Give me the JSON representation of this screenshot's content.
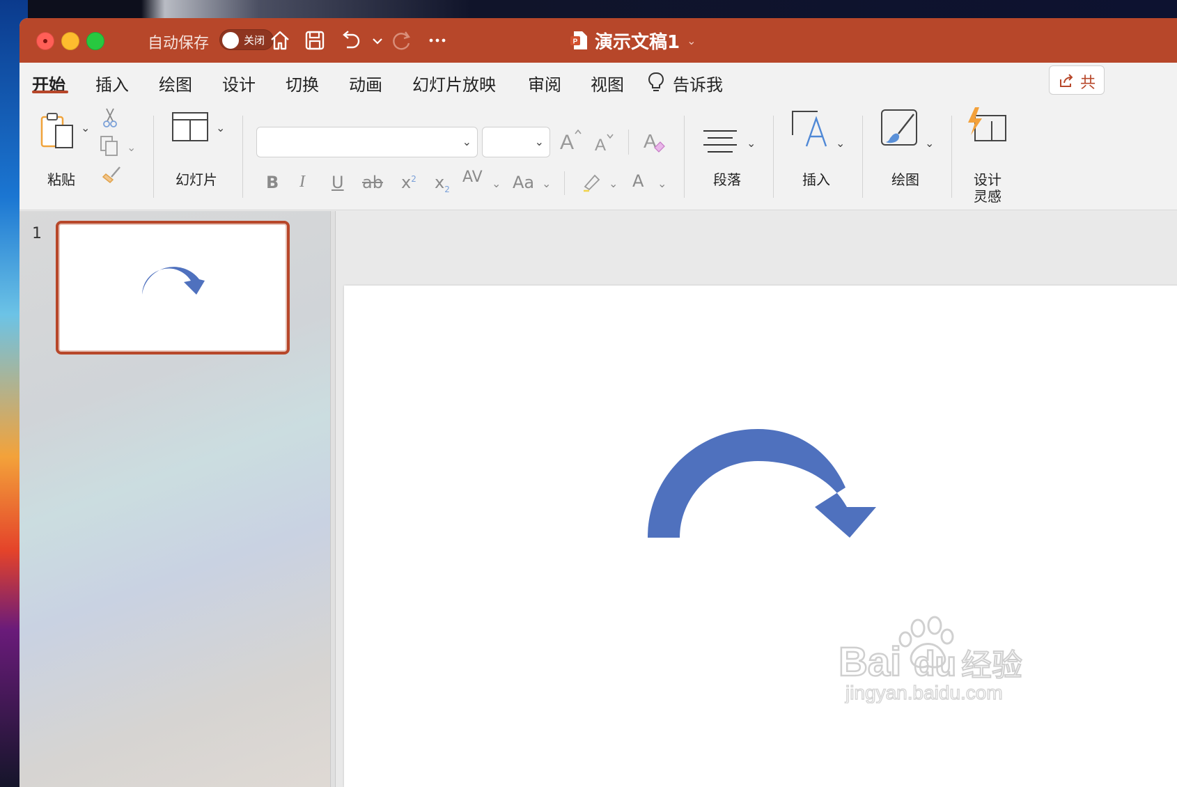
{
  "titlebar": {
    "autosave_label": "自动保存",
    "autosave_state": "关闭",
    "document_title": "演示文稿1",
    "accent_color": "#b7472a"
  },
  "tabs": [
    {
      "label": "开始",
      "active": true
    },
    {
      "label": "插入"
    },
    {
      "label": "绘图"
    },
    {
      "label": "设计"
    },
    {
      "label": "切换"
    },
    {
      "label": "动画"
    },
    {
      "label": "幻灯片放映"
    },
    {
      "label": "审阅"
    },
    {
      "label": "视图"
    },
    {
      "label": "告诉我"
    }
  ],
  "share_label": "共",
  "ribbon": {
    "paste": "粘贴",
    "slides": "幻灯片",
    "font_name": "",
    "font_size": "",
    "bold": "B",
    "italic": "I",
    "underline": "U",
    "strike": "ab",
    "superscript": "x",
    "subscript": "x",
    "spacing": "AV",
    "case": "Aa",
    "paragraph": "段落",
    "insert": "插入",
    "draw": "绘图",
    "designer_line1": "设计",
    "designer_line2": "灵感"
  },
  "slides_panel": {
    "slide_number": "1"
  },
  "shape_color": "#4f71be",
  "watermark": {
    "brand": "Bai",
    "brand2": "du",
    "cn": "经验",
    "url": "jingyan.baidu.com"
  }
}
